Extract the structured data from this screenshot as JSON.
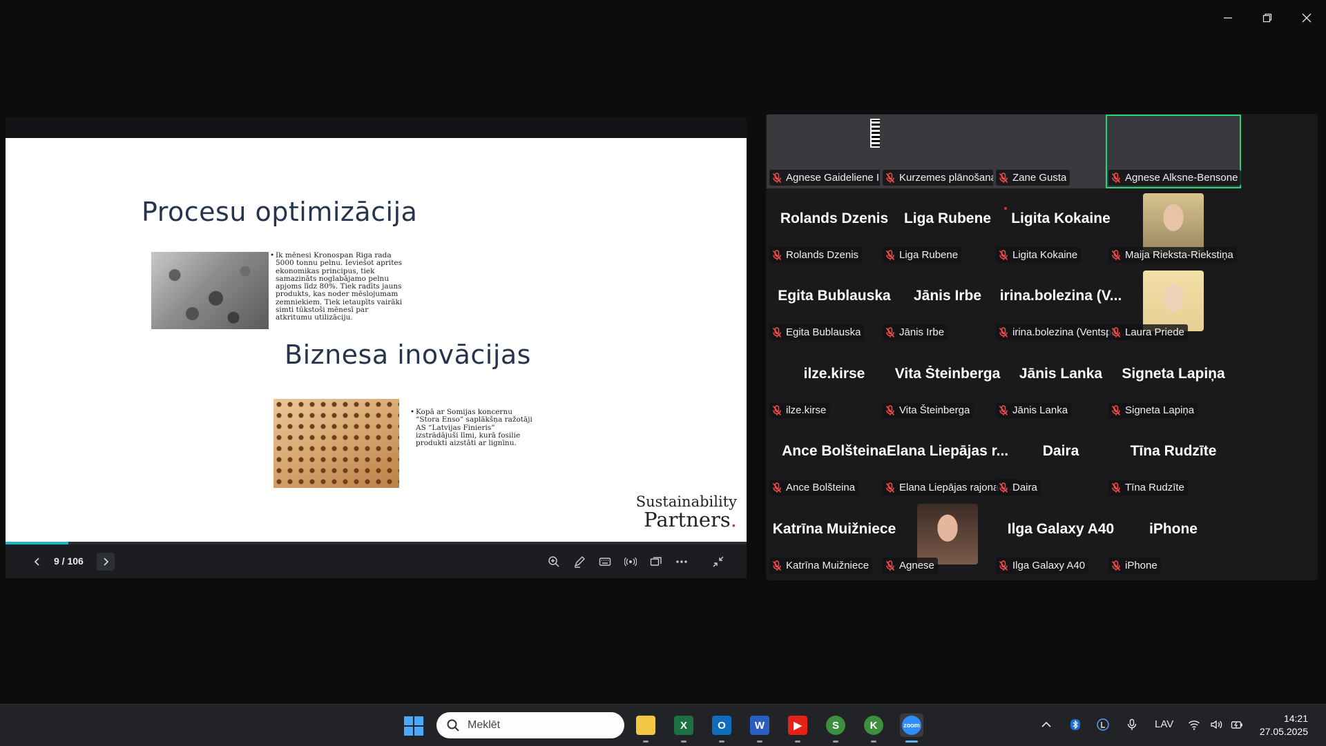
{
  "window": {
    "controls": [
      "minimize-icon",
      "restore-icon",
      "close-icon"
    ]
  },
  "slide": {
    "heading1": "Procesu optimizācija",
    "bullet1": "Ik mēnesi Kronospan Riga rada 5000 tonnu pelnu. Ieviešot aprites ekonomikas principus, tiek samazināts noglabājamo pelnu apjoms līdz 80%. Tiek radīts jauns produkts, kas noder mēslojumam zemniekiem. Tiek ietaupīts vairāki simti tūkstoši mēnesī par atkritumu utilizāciju.",
    "heading2": "Biznesa inovācijas",
    "bullet2": "Kopā ar Somijas koncernu “Stora Enso” saplākšņa ražotāji AS “Latvijas Finieris” izstrādājuši līmi, kurā fosilie produkti aizstāti ar lignīnu.",
    "logo_line1": "Sustainability",
    "logo_line2": "Partners",
    "logo_dot": "."
  },
  "presentation": {
    "page_indicator": "9 / 106",
    "progress_fraction": 0.085,
    "controls": [
      "zoom-in-icon",
      "annotate-icon",
      "keyboard-icon",
      "broadcast-icon",
      "switch-screen-icon",
      "more-icon",
      "exit-fullscreen-icon"
    ]
  },
  "gallery": {
    "accent_active": "#2ad37a",
    "participants": [
      {
        "label": "Agnese Gaideliene IEB...",
        "video": "v1",
        "active": false
      },
      {
        "label": "Kurzemes plānošanas ...",
        "video": "v2",
        "active": false
      },
      {
        "label": "Zane Gusta",
        "video": "v3",
        "active": false
      },
      {
        "label": "Agnese Alksne-Bensone",
        "video": "v4",
        "active": true
      },
      {
        "big": "Rolands Dzenis",
        "label": "Rolands Dzenis"
      },
      {
        "big": "Liga Rubene",
        "label": "Liga Rubene"
      },
      {
        "big": "Ligita Kokaine",
        "label": "Ligita Kokaine"
      },
      {
        "label": "Maija Rieksta-Riekstiņa",
        "avatar": "av-a"
      },
      {
        "big": "Egita Bublauska",
        "label": "Egita Bublauska"
      },
      {
        "big": "Jānis Irbe",
        "label": "Jānis Irbe"
      },
      {
        "big": "irina.bolezina (V...",
        "label": "irina.bolezina (Ventspil..."
      },
      {
        "label": "Laura Priede",
        "avatar": "av-b"
      },
      {
        "big": "ilze.kirse",
        "label": "ilze.kirse"
      },
      {
        "big": "Vita Šteinberga",
        "label": "Vita Šteinberga"
      },
      {
        "big": "Jānis Lanka",
        "label": "Jānis Lanka"
      },
      {
        "big": "Signeta Lapiņa",
        "label": "Signeta Lapiņa"
      },
      {
        "big": "Ance Bolšteina",
        "label": "Ance Bolšteina"
      },
      {
        "big": "Elana Liepājas r...",
        "label": "Elana Liepājas rajona p..."
      },
      {
        "big": "Daira",
        "label": "Daira"
      },
      {
        "big": "Tīna Rudzīte",
        "label": "Tīna Rudzīte"
      },
      {
        "big": "Katrīna Muižniece",
        "label": "Katrīna Muižniece"
      },
      {
        "label": "Agnese",
        "avatar": "av-c"
      },
      {
        "big": "Ilga Galaxy A40",
        "label": "Ilga Galaxy A40"
      },
      {
        "big": "iPhone",
        "label": "iPhone"
      }
    ]
  },
  "taskbar": {
    "search_placeholder": "Meklēt",
    "apps": [
      {
        "name": "file-explorer-icon",
        "glyph": "",
        "color": "#f2c744",
        "on": false
      },
      {
        "name": "excel-icon",
        "glyph": "X",
        "color": "#1d7044",
        "on": false
      },
      {
        "name": "outlook-icon",
        "glyph": "O",
        "color": "#0f6cbd",
        "on": false
      },
      {
        "name": "word-icon",
        "glyph": "W",
        "color": "#2b5cbf",
        "on": false
      },
      {
        "name": "youtube-icon",
        "glyph": "▶",
        "color": "#e62117",
        "on": false
      },
      {
        "name": "chrome-s-icon",
        "glyph": "S",
        "color": "#3c8f3f",
        "on": false
      },
      {
        "name": "chrome-k-icon",
        "glyph": "K",
        "color": "#3c8f3f",
        "on": false
      },
      {
        "name": "zoom-icon",
        "glyph": "zoom",
        "color": "#2d8cff",
        "on": true
      }
    ],
    "language": "LAV",
    "time": "14:21",
    "date": "27.05.2025"
  }
}
